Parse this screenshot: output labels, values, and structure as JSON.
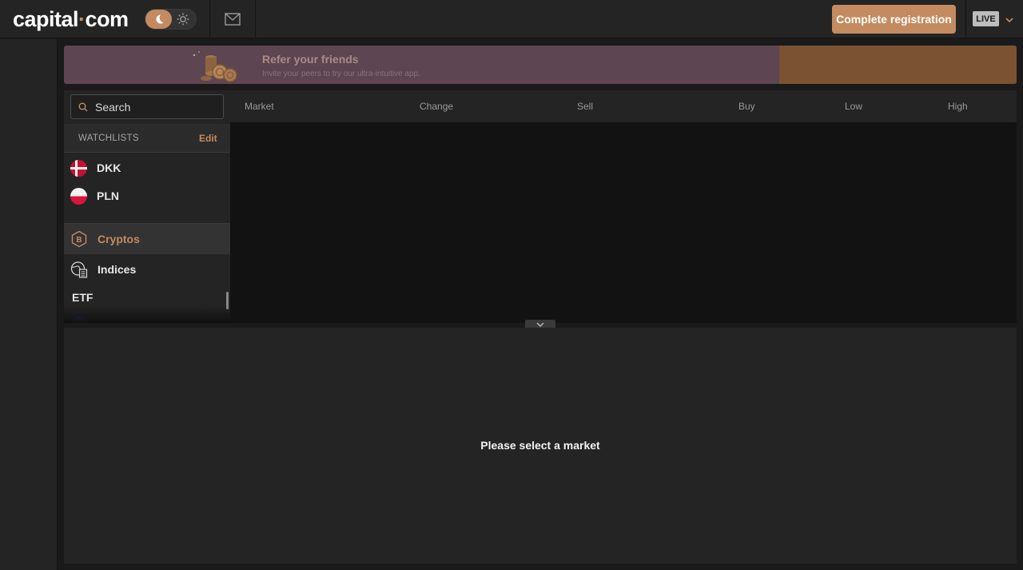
{
  "header": {
    "logo_text_1": "capital",
    "logo_dot": "·",
    "logo_text_2": "com",
    "register_label": "Complete registration",
    "account_mode": "LIVE",
    "icons": [
      "moon-icon",
      "sun-icon",
      "mail-icon",
      "chevron-down-icon"
    ],
    "accent_color": "#c38b5f"
  },
  "banner": {
    "title": "Refer your friends",
    "subtitle": "Invite your peers to try our ultra-intuitive app."
  },
  "markets": {
    "search_placeholder": "Search",
    "columns": [
      "Market",
      "Change",
      "Sell",
      "Buy",
      "Low",
      "High"
    ]
  },
  "sidebar": {
    "watchlists_title": "WATCHLISTS",
    "edit_label": "Edit",
    "fx_items": [
      {
        "label": "DKK",
        "icon": "denmark-flag-icon"
      },
      {
        "label": "PLN",
        "icon": "poland-flag-icon"
      }
    ],
    "categories": [
      {
        "label": "Cryptos",
        "icon": "bitcoin-icon",
        "active": true
      },
      {
        "label": "Indices",
        "icon": "globe-document-icon",
        "active": false
      }
    ],
    "etf_label": "ETF"
  },
  "detail": {
    "empty_message": "Please select a market"
  }
}
